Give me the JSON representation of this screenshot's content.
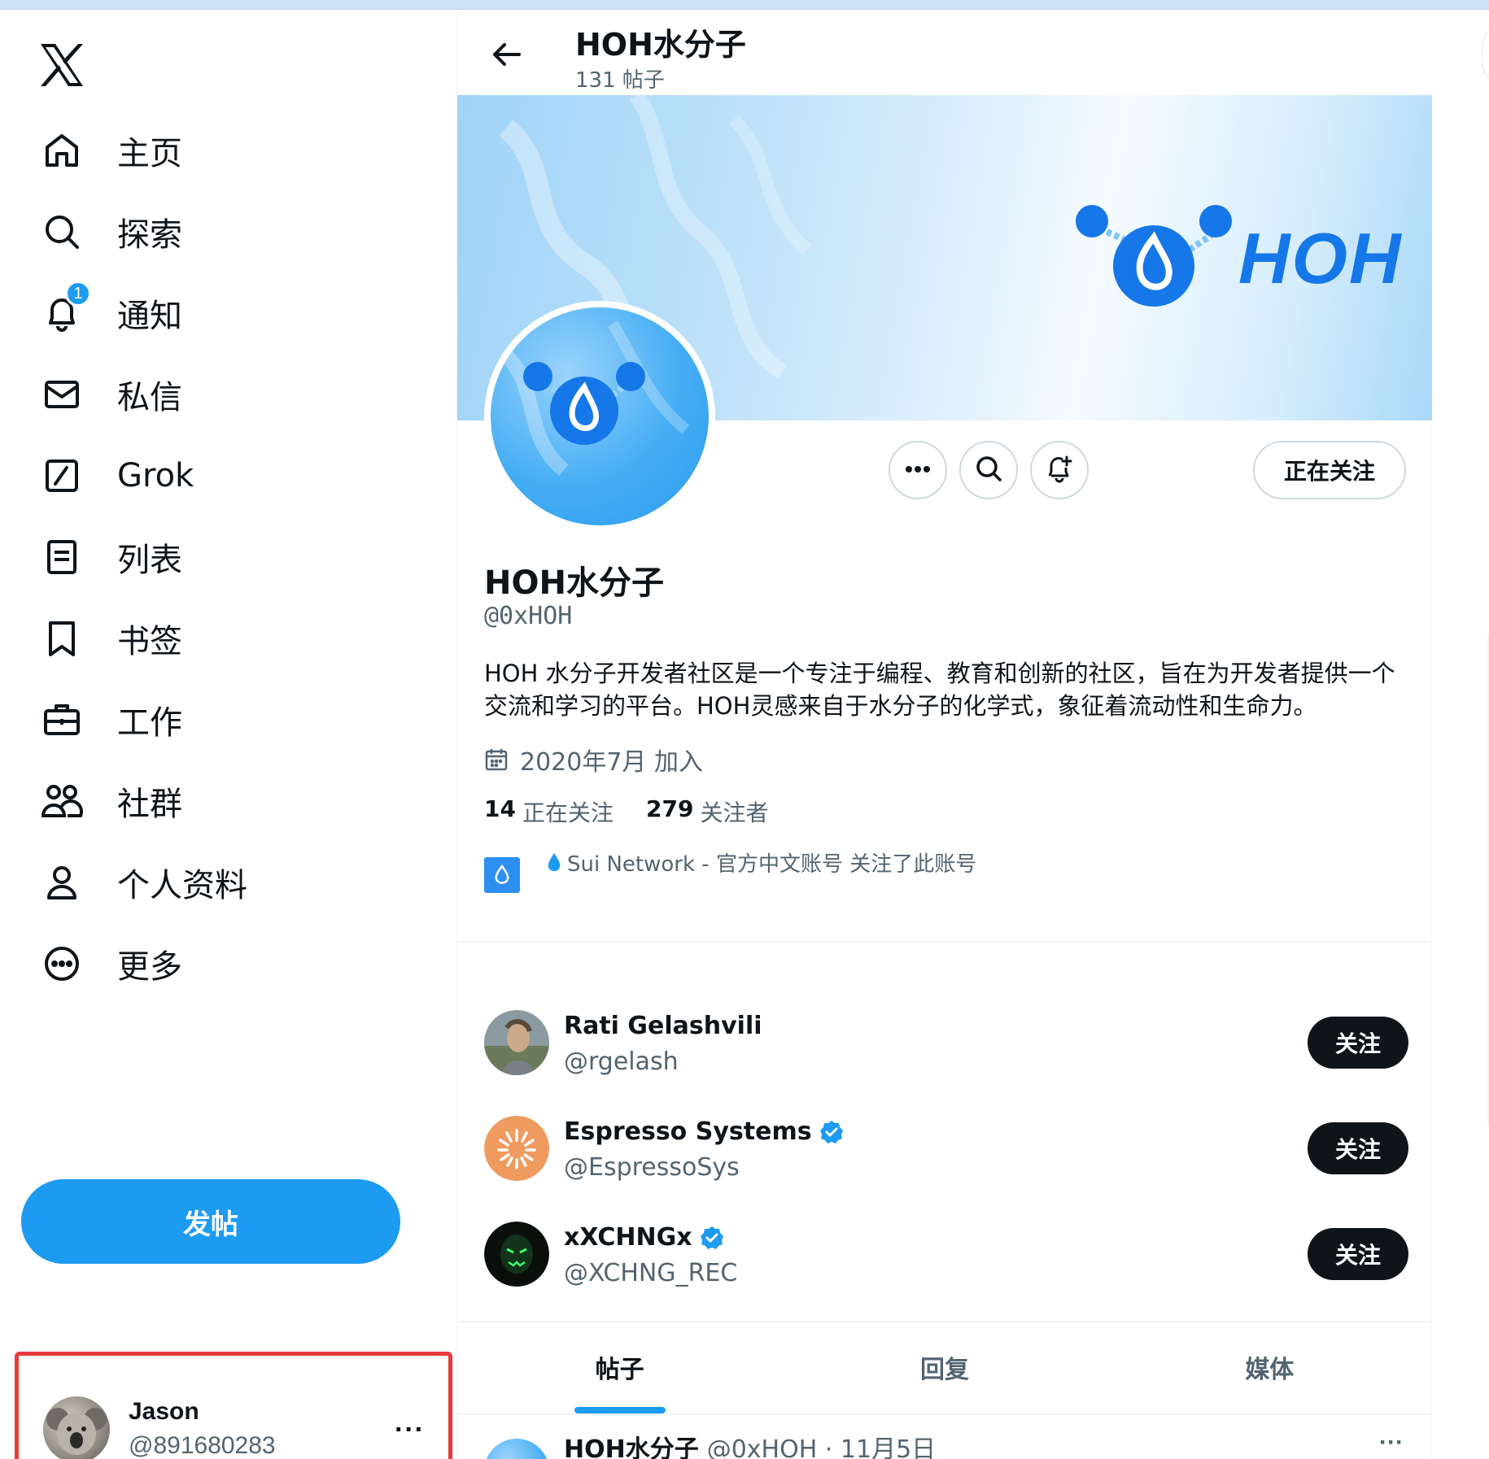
{
  "sidebar": {
    "items": [
      {
        "label": "主页",
        "icon": "home-icon"
      },
      {
        "label": "探索",
        "icon": "search-icon"
      },
      {
        "label": "通知",
        "icon": "bell-icon",
        "badge": "1"
      },
      {
        "label": "私信",
        "icon": "mail-icon"
      },
      {
        "label": "Grok",
        "icon": "grok-icon"
      },
      {
        "label": "列表",
        "icon": "list-icon"
      },
      {
        "label": "书签",
        "icon": "bookmark-icon"
      },
      {
        "label": "工作",
        "icon": "briefcase-icon"
      },
      {
        "label": "社群",
        "icon": "communities-icon"
      },
      {
        "label": "个人资料",
        "icon": "person-icon"
      },
      {
        "label": "更多",
        "icon": "more-circle-icon"
      }
    ],
    "post_button": "发帖",
    "account": {
      "name": "Jason",
      "handle": "@891680283",
      "more": "···"
    }
  },
  "header": {
    "title": "HOH水分子",
    "subtitle": "131 帖子"
  },
  "banner": {
    "logo_text": "HOH"
  },
  "profile": {
    "name": "HOH水分子",
    "handle": "@0xHOH",
    "bio": "HOH 水分子开发者社区是一个专注于编程、教育和创新的社区，旨在为开发者提供一个交流和学习的平台。HOH灵感来自于水分子的化学式，象征着流动性和生命力。",
    "joined": "2020年7月 加入",
    "following_count": "14",
    "following_label": "正在关注",
    "followers_count": "279",
    "followers_label": "关注者",
    "followed_by": "Sui Network - 官方中文账号 关注了此账号",
    "following_button": "正在关注"
  },
  "suggestions": [
    {
      "name": "Rati Gelashvili",
      "handle": "@rgelash",
      "verified": false,
      "button": "关注"
    },
    {
      "name": "Espresso Systems",
      "handle": "@EspressoSys",
      "verified": true,
      "button": "关注"
    },
    {
      "name": "xXCHNGx",
      "handle": "@XCHNG_REC",
      "verified": true,
      "button": "关注"
    }
  ],
  "tabs": [
    {
      "label": "帖子",
      "active": true
    },
    {
      "label": "回复",
      "active": false
    },
    {
      "label": "媒体",
      "active": false
    }
  ],
  "post": {
    "author": "HOH水分子",
    "meta": "@0xHOH · 11月5日",
    "more": "···"
  },
  "colors": {
    "accent": "#1d9bf0",
    "text": "#0f1419",
    "muted": "#536471",
    "highlight_border": "#e8393d"
  }
}
